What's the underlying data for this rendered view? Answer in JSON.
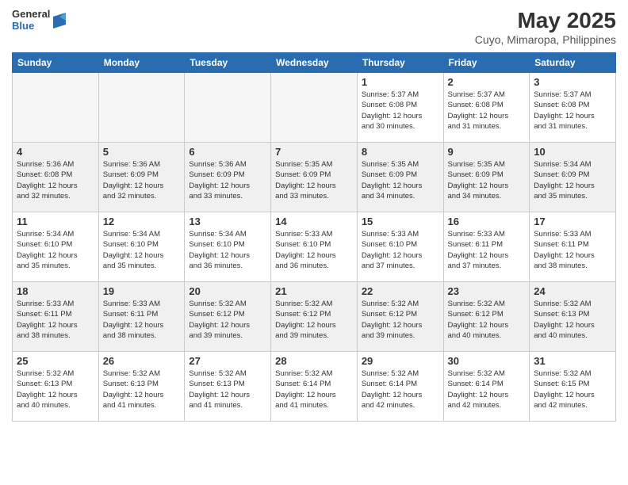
{
  "logo": {
    "general": "General",
    "blue": "Blue"
  },
  "title": {
    "month_year": "May 2025",
    "location": "Cuyo, Mimaropa, Philippines"
  },
  "weekdays": [
    "Sunday",
    "Monday",
    "Tuesday",
    "Wednesday",
    "Thursday",
    "Friday",
    "Saturday"
  ],
  "weeks": [
    [
      {
        "day": "",
        "info": ""
      },
      {
        "day": "",
        "info": ""
      },
      {
        "day": "",
        "info": ""
      },
      {
        "day": "",
        "info": ""
      },
      {
        "day": "1",
        "info": "Sunrise: 5:37 AM\nSunset: 6:08 PM\nDaylight: 12 hours\nand 30 minutes."
      },
      {
        "day": "2",
        "info": "Sunrise: 5:37 AM\nSunset: 6:08 PM\nDaylight: 12 hours\nand 31 minutes."
      },
      {
        "day": "3",
        "info": "Sunrise: 5:37 AM\nSunset: 6:08 PM\nDaylight: 12 hours\nand 31 minutes."
      }
    ],
    [
      {
        "day": "4",
        "info": "Sunrise: 5:36 AM\nSunset: 6:08 PM\nDaylight: 12 hours\nand 32 minutes."
      },
      {
        "day": "5",
        "info": "Sunrise: 5:36 AM\nSunset: 6:09 PM\nDaylight: 12 hours\nand 32 minutes."
      },
      {
        "day": "6",
        "info": "Sunrise: 5:36 AM\nSunset: 6:09 PM\nDaylight: 12 hours\nand 33 minutes."
      },
      {
        "day": "7",
        "info": "Sunrise: 5:35 AM\nSunset: 6:09 PM\nDaylight: 12 hours\nand 33 minutes."
      },
      {
        "day": "8",
        "info": "Sunrise: 5:35 AM\nSunset: 6:09 PM\nDaylight: 12 hours\nand 34 minutes."
      },
      {
        "day": "9",
        "info": "Sunrise: 5:35 AM\nSunset: 6:09 PM\nDaylight: 12 hours\nand 34 minutes."
      },
      {
        "day": "10",
        "info": "Sunrise: 5:34 AM\nSunset: 6:09 PM\nDaylight: 12 hours\nand 35 minutes."
      }
    ],
    [
      {
        "day": "11",
        "info": "Sunrise: 5:34 AM\nSunset: 6:10 PM\nDaylight: 12 hours\nand 35 minutes."
      },
      {
        "day": "12",
        "info": "Sunrise: 5:34 AM\nSunset: 6:10 PM\nDaylight: 12 hours\nand 35 minutes."
      },
      {
        "day": "13",
        "info": "Sunrise: 5:34 AM\nSunset: 6:10 PM\nDaylight: 12 hours\nand 36 minutes."
      },
      {
        "day": "14",
        "info": "Sunrise: 5:33 AM\nSunset: 6:10 PM\nDaylight: 12 hours\nand 36 minutes."
      },
      {
        "day": "15",
        "info": "Sunrise: 5:33 AM\nSunset: 6:10 PM\nDaylight: 12 hours\nand 37 minutes."
      },
      {
        "day": "16",
        "info": "Sunrise: 5:33 AM\nSunset: 6:11 PM\nDaylight: 12 hours\nand 37 minutes."
      },
      {
        "day": "17",
        "info": "Sunrise: 5:33 AM\nSunset: 6:11 PM\nDaylight: 12 hours\nand 38 minutes."
      }
    ],
    [
      {
        "day": "18",
        "info": "Sunrise: 5:33 AM\nSunset: 6:11 PM\nDaylight: 12 hours\nand 38 minutes."
      },
      {
        "day": "19",
        "info": "Sunrise: 5:33 AM\nSunset: 6:11 PM\nDaylight: 12 hours\nand 38 minutes."
      },
      {
        "day": "20",
        "info": "Sunrise: 5:32 AM\nSunset: 6:12 PM\nDaylight: 12 hours\nand 39 minutes."
      },
      {
        "day": "21",
        "info": "Sunrise: 5:32 AM\nSunset: 6:12 PM\nDaylight: 12 hours\nand 39 minutes."
      },
      {
        "day": "22",
        "info": "Sunrise: 5:32 AM\nSunset: 6:12 PM\nDaylight: 12 hours\nand 39 minutes."
      },
      {
        "day": "23",
        "info": "Sunrise: 5:32 AM\nSunset: 6:12 PM\nDaylight: 12 hours\nand 40 minutes."
      },
      {
        "day": "24",
        "info": "Sunrise: 5:32 AM\nSunset: 6:13 PM\nDaylight: 12 hours\nand 40 minutes."
      }
    ],
    [
      {
        "day": "25",
        "info": "Sunrise: 5:32 AM\nSunset: 6:13 PM\nDaylight: 12 hours\nand 40 minutes."
      },
      {
        "day": "26",
        "info": "Sunrise: 5:32 AM\nSunset: 6:13 PM\nDaylight: 12 hours\nand 41 minutes."
      },
      {
        "day": "27",
        "info": "Sunrise: 5:32 AM\nSunset: 6:13 PM\nDaylight: 12 hours\nand 41 minutes."
      },
      {
        "day": "28",
        "info": "Sunrise: 5:32 AM\nSunset: 6:14 PM\nDaylight: 12 hours\nand 41 minutes."
      },
      {
        "day": "29",
        "info": "Sunrise: 5:32 AM\nSunset: 6:14 PM\nDaylight: 12 hours\nand 42 minutes."
      },
      {
        "day": "30",
        "info": "Sunrise: 5:32 AM\nSunset: 6:14 PM\nDaylight: 12 hours\nand 42 minutes."
      },
      {
        "day": "31",
        "info": "Sunrise: 5:32 AM\nSunset: 6:15 PM\nDaylight: 12 hours\nand 42 minutes."
      }
    ]
  ]
}
